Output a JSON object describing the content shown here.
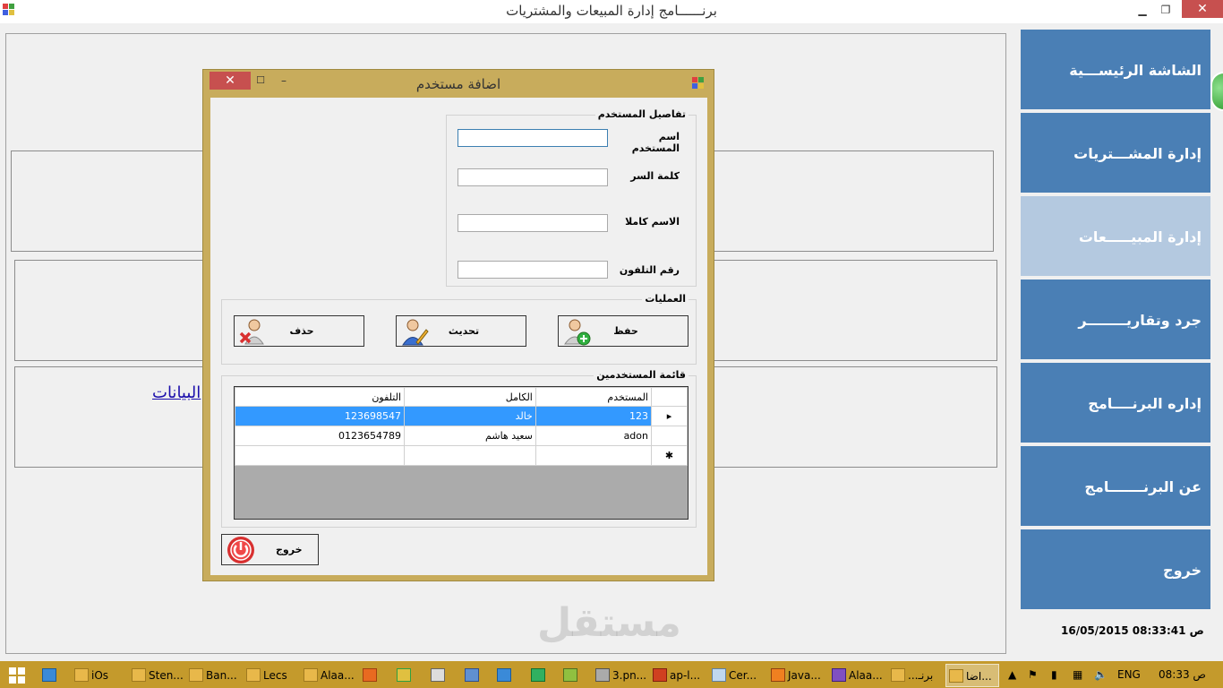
{
  "window": {
    "title": "برنــــــامج إدارة المبيعات والمشتريات",
    "minimize": "▁",
    "maximize": "❐",
    "close": "✕"
  },
  "main": {
    "link_text": "البيانات"
  },
  "sidebar": {
    "items": [
      {
        "label": "الشاشة الرئيســـية"
      },
      {
        "label": "إدارة المشـــتريات"
      },
      {
        "label": "إدارة المبيـــــعات"
      },
      {
        "label": "جرد وتقاريــــــــر"
      },
      {
        "label": "إداره البرنــــامج"
      },
      {
        "label": "عن البرنـــــــامج"
      },
      {
        "label": "خروج"
      }
    ],
    "datetime": "16/05/2015 08:33:41 ص"
  },
  "dialog": {
    "title": "اضافة مستخدم",
    "close": "✕",
    "maximize": "☐",
    "minimize": "–",
    "user_details": {
      "title": "تفاصيل المستخدم",
      "username_label": "اسم المستخدم",
      "password_label": "كلمة السر",
      "fullname_label": "الاسم كاملا",
      "phone_label": "رقم التلفون",
      "username_value": "",
      "password_value": "",
      "fullname_value": "",
      "phone_value": ""
    },
    "operations": {
      "title": "العمليات",
      "delete_label": "حذف",
      "update_label": "تحديث",
      "save_label": "حفظ"
    },
    "users_list": {
      "title": "قائمة المستخدمين",
      "columns": [
        "التلفون",
        "الكامل",
        "المستخدم"
      ],
      "rows": [
        {
          "phone": "123698547",
          "fullname": "خالد",
          "username": "123",
          "marker": "▸"
        },
        {
          "phone": "0123654789",
          "fullname": "سعيد هاشم",
          "username": "adon",
          "marker": ""
        }
      ],
      "new_row_marker": "✱"
    },
    "exit_label": "خروج"
  },
  "taskbar": {
    "items": [
      {
        "label": "iOs"
      },
      {
        "label": "Sten..."
      },
      {
        "label": "Ban..."
      },
      {
        "label": "Lecs"
      },
      {
        "label": "Alaa..."
      },
      {
        "label": ""
      },
      {
        "label": ""
      },
      {
        "label": ""
      },
      {
        "label": ""
      },
      {
        "label": ""
      },
      {
        "label": ""
      },
      {
        "label": ""
      },
      {
        "label": "3.pn..."
      },
      {
        "label": "ap-l..."
      },
      {
        "label": "Cer..."
      },
      {
        "label": "Java..."
      },
      {
        "label": "Alaa..."
      },
      {
        "label": "...برنـ"
      },
      {
        "label": "اضا..."
      }
    ],
    "lang": "ENG",
    "clock": "08:33 ص"
  },
  "watermark": "مستقل",
  "colors": {
    "sidebar": "#4a7fb5",
    "sidebar_active": "#b4c9e0",
    "dialog_frame": "#c8ac5c",
    "taskbar": "#c49a2c",
    "selection": "#3399ff"
  }
}
